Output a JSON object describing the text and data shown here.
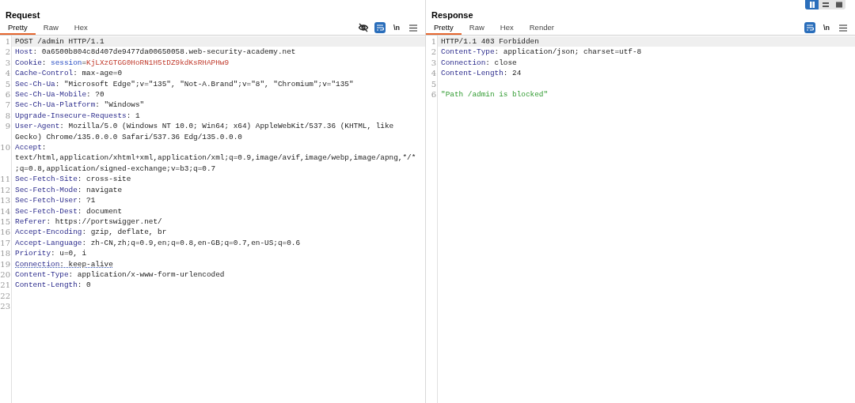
{
  "layout_toggle": [
    {
      "kind": "columns",
      "selected": true
    },
    {
      "kind": "rows",
      "selected": false
    },
    {
      "kind": "single",
      "selected": false
    }
  ],
  "panels": [
    {
      "title": "Request",
      "tabs": [
        {
          "label": "Pretty",
          "selected": true
        },
        {
          "label": "Raw",
          "selected": false
        },
        {
          "label": "Hex",
          "selected": false
        }
      ],
      "toolbar": [
        {
          "kind": "hide",
          "selected": false
        },
        {
          "kind": "wrap",
          "selected": true
        },
        {
          "kind": "newline",
          "label": "\\n",
          "selected": false
        },
        {
          "kind": "menu",
          "selected": false
        }
      ],
      "lines": [
        {
          "number": "1",
          "current": true,
          "flagged": false,
          "rows": [
            [
              {
                "kind": "plain",
                "text": "POST /admin HTTP/1.1"
              }
            ]
          ]
        },
        {
          "number": "2",
          "current": false,
          "flagged": false,
          "rows": [
            [
              {
                "kind": "name",
                "text": "Host"
              },
              {
                "kind": "plain",
                "text": ": 0a6500b804c8d407de9477da00650058.web-security-academy.net"
              }
            ]
          ]
        },
        {
          "number": "3",
          "current": false,
          "flagged": false,
          "rows": [
            [
              {
                "kind": "name",
                "text": "Cookie"
              },
              {
                "kind": "plain",
                "text": ": "
              },
              {
                "kind": "param",
                "text": "session"
              },
              {
                "kind": "plain",
                "text": "="
              },
              {
                "kind": "param_value",
                "text": "KjLXzGTGG0HoRN1H5tDZ9kdKsRHAPHw9"
              }
            ]
          ]
        },
        {
          "number": "4",
          "current": false,
          "flagged": false,
          "rows": [
            [
              {
                "kind": "name",
                "text": "Cache-Control"
              },
              {
                "kind": "plain",
                "text": ": max-age=0"
              }
            ]
          ]
        },
        {
          "number": "5",
          "current": false,
          "flagged": false,
          "rows": [
            [
              {
                "kind": "name",
                "text": "Sec-Ch-Ua"
              },
              {
                "kind": "plain",
                "text": ": \"Microsoft Edge\";v=\"135\", \"Not-A.Brand\";v=\"8\", \"Chromium\";v=\"135\""
              }
            ]
          ]
        },
        {
          "number": "6",
          "current": false,
          "flagged": false,
          "rows": [
            [
              {
                "kind": "name",
                "text": "Sec-Ch-Ua-Mobile"
              },
              {
                "kind": "plain",
                "text": ": ?0"
              }
            ]
          ]
        },
        {
          "number": "7",
          "current": false,
          "flagged": false,
          "rows": [
            [
              {
                "kind": "name",
                "text": "Sec-Ch-Ua-Platform"
              },
              {
                "kind": "plain",
                "text": ": \"Windows\""
              }
            ]
          ]
        },
        {
          "number": "8",
          "current": false,
          "flagged": false,
          "rows": [
            [
              {
                "kind": "name",
                "text": "Upgrade-Insecure-Requests"
              },
              {
                "kind": "plain",
                "text": ": 1"
              }
            ]
          ]
        },
        {
          "number": "9",
          "current": false,
          "flagged": false,
          "rows": [
            [
              {
                "kind": "name",
                "text": "User-Agent"
              },
              {
                "kind": "plain",
                "text": ": Mozilla/5.0 (Windows NT 10.0; Win64; x64) AppleWebKit/537.36 (KHTML, like"
              }
            ],
            [
              {
                "kind": "plain",
                "text": "Gecko) Chrome/135.0.0.0 Safari/537.36 Edg/135.0.0.0"
              }
            ]
          ]
        },
        {
          "number": "10",
          "current": false,
          "flagged": false,
          "rows": [
            [
              {
                "kind": "name",
                "text": "Accept"
              },
              {
                "kind": "plain",
                "text": ":"
              }
            ],
            [
              {
                "kind": "plain",
                "text": "text/html,application/xhtml+xml,application/xml;q=0.9,image/avif,image/webp,image/apng,*/*"
              }
            ],
            [
              {
                "kind": "plain",
                "text": ";q=0.8,application/signed-exchange;v=b3;q=0.7"
              }
            ]
          ]
        },
        {
          "number": "11",
          "current": false,
          "flagged": false,
          "rows": [
            [
              {
                "kind": "name",
                "text": "Sec-Fetch-Site"
              },
              {
                "kind": "plain",
                "text": ": cross-site"
              }
            ]
          ]
        },
        {
          "number": "12",
          "current": false,
          "flagged": false,
          "rows": [
            [
              {
                "kind": "name",
                "text": "Sec-Fetch-Mode"
              },
              {
                "kind": "plain",
                "text": ": navigate"
              }
            ]
          ]
        },
        {
          "number": "13",
          "current": false,
          "flagged": false,
          "rows": [
            [
              {
                "kind": "name",
                "text": "Sec-Fetch-User"
              },
              {
                "kind": "plain",
                "text": ": ?1"
              }
            ]
          ]
        },
        {
          "number": "14",
          "current": false,
          "flagged": false,
          "rows": [
            [
              {
                "kind": "name",
                "text": "Sec-Fetch-Dest"
              },
              {
                "kind": "plain",
                "text": ": document"
              }
            ]
          ]
        },
        {
          "number": "15",
          "current": false,
          "flagged": false,
          "rows": [
            [
              {
                "kind": "name",
                "text": "Referer"
              },
              {
                "kind": "plain",
                "text": ": https://portswigger.net/"
              }
            ]
          ]
        },
        {
          "number": "16",
          "current": false,
          "flagged": false,
          "rows": [
            [
              {
                "kind": "name",
                "text": "Accept-Encoding"
              },
              {
                "kind": "plain",
                "text": ": gzip, deflate, br"
              }
            ]
          ]
        },
        {
          "number": "17",
          "current": false,
          "flagged": false,
          "rows": [
            [
              {
                "kind": "name",
                "text": "Accept-Language"
              },
              {
                "kind": "plain",
                "text": ": zh-CN,zh;q=0.9,en;q=0.8,en-GB;q=0.7,en-US;q=0.6"
              }
            ]
          ]
        },
        {
          "number": "18",
          "current": false,
          "flagged": false,
          "rows": [
            [
              {
                "kind": "name",
                "text": "Priority"
              },
              {
                "kind": "plain",
                "text": ": u=0, i"
              }
            ]
          ]
        },
        {
          "number": "19",
          "current": false,
          "flagged": true,
          "rows": [
            [
              {
                "kind": "name",
                "text": "Connection"
              },
              {
                "kind": "plain",
                "text": ": keep-alive"
              }
            ]
          ]
        },
        {
          "number": "20",
          "current": false,
          "flagged": false,
          "rows": [
            [
              {
                "kind": "name",
                "text": "Content-Type"
              },
              {
                "kind": "plain",
                "text": ": application/x-www-form-urlencoded"
              }
            ]
          ]
        },
        {
          "number": "21",
          "current": false,
          "flagged": false,
          "rows": [
            [
              {
                "kind": "name",
                "text": "Content-Length"
              },
              {
                "kind": "plain",
                "text": ": 0"
              }
            ]
          ]
        },
        {
          "number": "22",
          "current": false,
          "flagged": false,
          "rows": [
            []
          ]
        },
        {
          "number": "23",
          "current": false,
          "flagged": false,
          "rows": [
            []
          ]
        }
      ]
    },
    {
      "title": "Response",
      "tabs": [
        {
          "label": "Pretty",
          "selected": true
        },
        {
          "label": "Raw",
          "selected": false
        },
        {
          "label": "Hex",
          "selected": false
        },
        {
          "label": "Render",
          "selected": false
        }
      ],
      "toolbar": [
        {
          "kind": "wrap",
          "selected": true
        },
        {
          "kind": "newline",
          "label": "\\n",
          "selected": false
        },
        {
          "kind": "menu",
          "selected": false
        }
      ],
      "lines": [
        {
          "number": "1",
          "current": true,
          "flagged": false,
          "rows": [
            [
              {
                "kind": "plain",
                "text": "HTTP/1.1 403 Forbidden"
              }
            ]
          ]
        },
        {
          "number": "2",
          "current": false,
          "flagged": false,
          "rows": [
            [
              {
                "kind": "name",
                "text": "Content-Type"
              },
              {
                "kind": "plain",
                "text": ": application/json; charset=utf-8"
              }
            ]
          ]
        },
        {
          "number": "3",
          "current": false,
          "flagged": false,
          "rows": [
            [
              {
                "kind": "name",
                "text": "Connection"
              },
              {
                "kind": "plain",
                "text": ": close"
              }
            ]
          ]
        },
        {
          "number": "4",
          "current": false,
          "flagged": false,
          "rows": [
            [
              {
                "kind": "name",
                "text": "Content-Length"
              },
              {
                "kind": "plain",
                "text": ": 24"
              }
            ]
          ]
        },
        {
          "number": "5",
          "current": false,
          "flagged": false,
          "rows": [
            []
          ]
        },
        {
          "number": "6",
          "current": false,
          "flagged": false,
          "rows": [
            [
              {
                "kind": "string",
                "text": "\"Path /admin is blocked\""
              }
            ]
          ]
        }
      ]
    }
  ]
}
